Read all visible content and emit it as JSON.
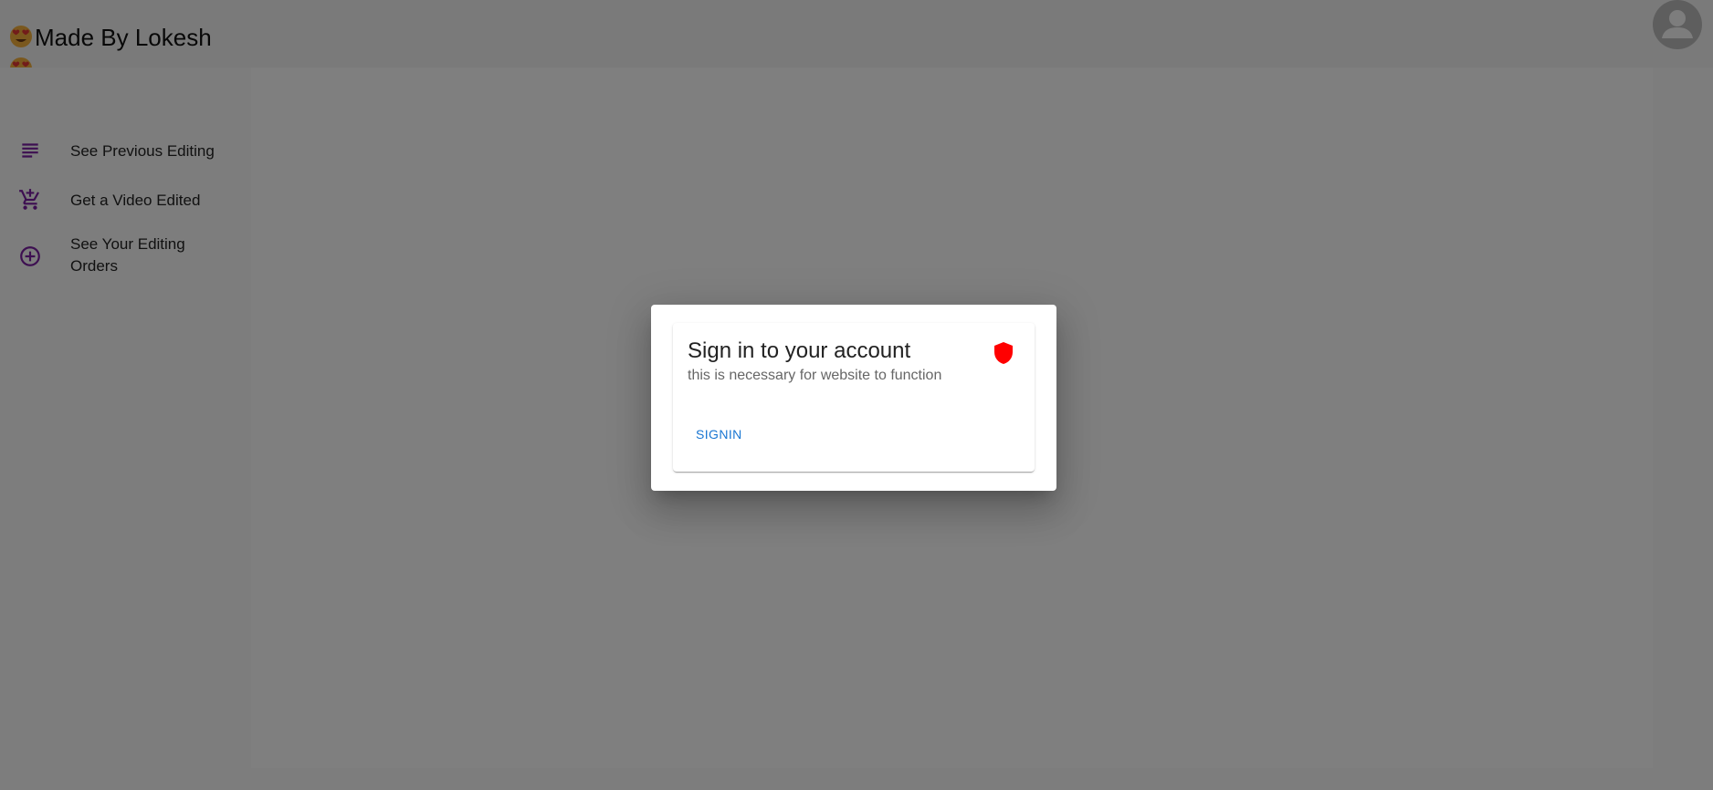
{
  "app": {
    "brand_title": "Made By Lokesh"
  },
  "header": {
    "avatar_icon": "account-circle-icon"
  },
  "sidebar": {
    "items": [
      {
        "label": "See Previous Editing",
        "icon": "subject-lines-icon"
      },
      {
        "label": "Get a Video Edited",
        "icon": "add-shopping-cart-icon"
      },
      {
        "label": "See Your Editing Orders",
        "icon": "add-circle-outline-icon"
      }
    ]
  },
  "dialog": {
    "title": "Sign in to your account",
    "subtitle": "this is necessary for website to function",
    "signin_label": "SIGNIN",
    "icon": "shield-icon"
  },
  "colors": {
    "accent_purple": "#7b1fa2",
    "button_blue": "#1976d2",
    "shield_red": "#ff0000"
  }
}
